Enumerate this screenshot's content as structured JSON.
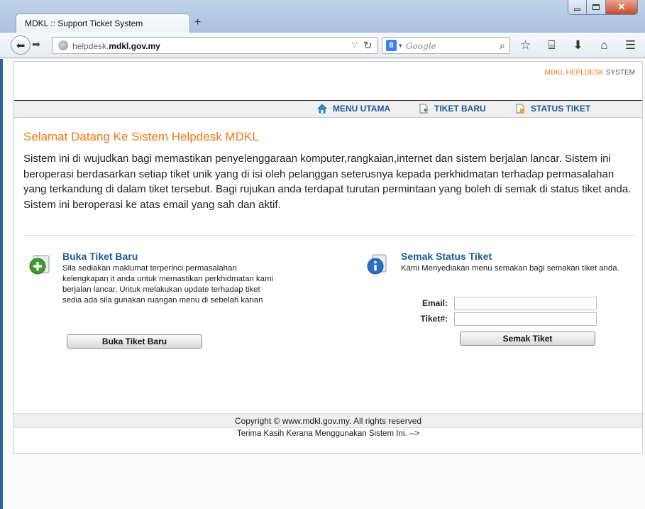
{
  "browser": {
    "tab_title": "MDKL :: Support Ticket System",
    "new_tab": "+",
    "url_prefix": "helpdesk.",
    "url_domain": "mdkl.gov.my",
    "search_engine": "8",
    "search_placeholder": "Google"
  },
  "header": {
    "brand_highlight": "MDKL HEPLDESK",
    "brand_rest": "SYSTEM"
  },
  "nav": {
    "home": "MENU UTAMA",
    "new_ticket": "TIKET BARU",
    "ticket_status": "STATUS TIKET"
  },
  "welcome": {
    "title": "Selamat Datang Ke Sistem Helpdesk MDKL",
    "body": "Sistem ini di wujudkan bagi memastikan penyelenggaraan komputer,rangkaian,internet dan sistem berjalan lancar. Sistem ini beroperasi berdasarkan setiap tiket unik yang di isi oleh pelanggan seterusnya kepada perkhidmatan terhadap permasalahan yang terkandung di dalam tiket tersebut. Bagi rujukan anda terdapat turutan permintaan yang boleh di semak di status tiket anda. Sistem ini beroperasi ke atas email yang sah dan aktif."
  },
  "new_ticket_box": {
    "title": "Buka Tiket Baru",
    "description": "Sila sediakan maklumat terperinci permasalahan kelengkapan it anda untuk memastikan perkhidmatan kami berjalan lancar. Untuk melakukan update terhadap tiket sedia ada sila gunakan ruangan menu di sebelah kanan",
    "button": "Buka Tiket Baru"
  },
  "status_box": {
    "title": "Semak Status Tiket",
    "description": "Kami Menyediakan menu semakan bagi semakan tiket anda.",
    "email_label": "Email:",
    "email_value": "",
    "ticket_label": "Tiket#:",
    "ticket_value": "",
    "button": "Semak Tiket"
  },
  "footer": {
    "copyright": "Copyright © www.mdkl.gov.my. All rights reserved",
    "thanks": "Terima Kasih Kerana Menggunakan Sistem Ini. -->"
  },
  "colors": {
    "accent_orange": "#f07b12",
    "link_blue": "#1e5a97",
    "icon_green": "#3f9b2c",
    "icon_blue": "#2b6fc4"
  },
  "icons": {
    "home": "home-icon",
    "new_ticket": "document-add-icon",
    "ticket_status": "document-status-icon",
    "new_box": "plus-circle-icon",
    "status_box": "info-icon"
  }
}
